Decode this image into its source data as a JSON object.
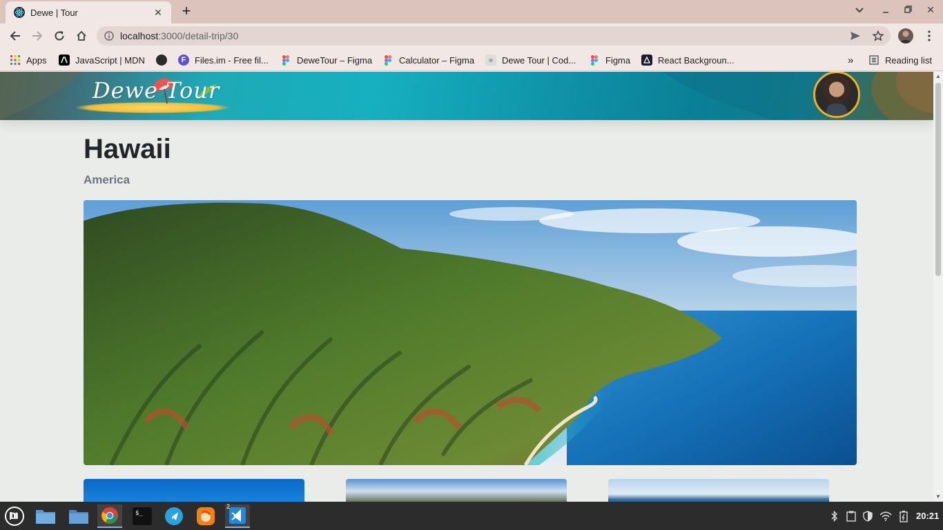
{
  "browser": {
    "tab_title": "Dewe | Tour",
    "url_host": "localhost",
    "url_path": ":3000/detail-trip/30",
    "bookmarks": [
      {
        "label": "Apps",
        "icon": "apps-grid-icon"
      },
      {
        "label": "JavaScript | MDN",
        "icon": "mdn-icon"
      },
      {
        "label": "",
        "icon": "circle-dark-icon"
      },
      {
        "label": "Files.im - Free fil...",
        "icon": "files-im-icon"
      },
      {
        "label": "DeweTour – Figma",
        "icon": "figma-icon"
      },
      {
        "label": "Calculator – Figma",
        "icon": "figma-icon"
      },
      {
        "label": "Dewe Tour | Cod...",
        "icon": "codesign-icon"
      },
      {
        "label": "Figma",
        "icon": "figma-icon"
      },
      {
        "label": "React Backgroun...",
        "icon": "react-icon"
      }
    ],
    "overflow_label": "»",
    "reading_list_label": "Reading list"
  },
  "page": {
    "logo_text": "Dewe Tour",
    "trip": {
      "title": "Hawaii",
      "country": "America"
    }
  },
  "taskbar": {
    "clock": "20:21",
    "vscode_badge": "2"
  },
  "colors": {
    "accent_gold": "#f2b01e",
    "page_bg": "#e9ece9",
    "title_text": "#212529",
    "subtitle_text": "#6c757d"
  }
}
